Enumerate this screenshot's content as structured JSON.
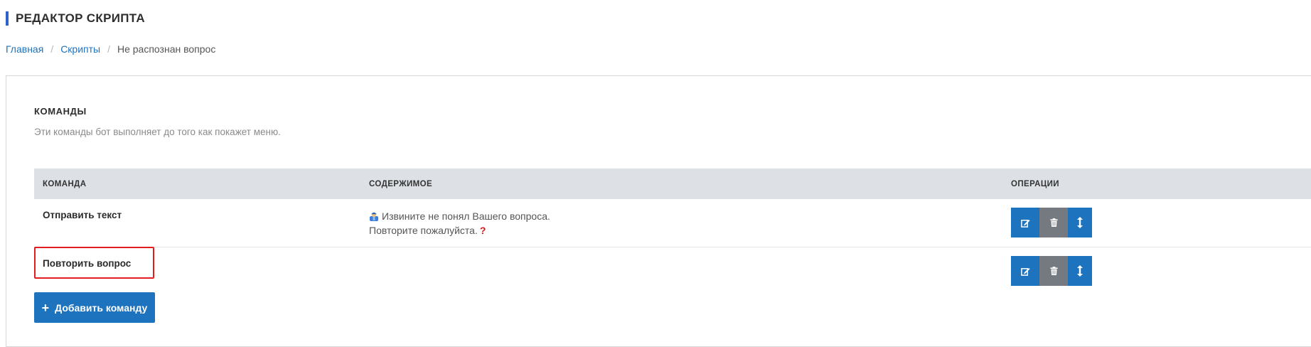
{
  "header": {
    "title": "РЕДАКТОР СКРИПТА"
  },
  "breadcrumb": {
    "home": "Главная",
    "scripts": "Скрипты",
    "current": "Не распознан вопрос"
  },
  "section": {
    "title": "КОМАНДЫ",
    "description": "Эти команды бот выполняет до того как покажет меню."
  },
  "table": {
    "headers": {
      "command": "КОМАНДА",
      "content": "СОДЕРЖИМОЕ",
      "operations": "ОПЕРАЦИИ"
    },
    "rows": [
      {
        "command": "Отправить текст",
        "content_line1": "Извините не понял Вашего вопроса.",
        "content_line2": "Повторите пожалуйста."
      },
      {
        "command": "Повторить вопрос",
        "content_line1": "",
        "content_line2": ""
      }
    ]
  },
  "add_button": {
    "label": "Добавить команду"
  },
  "colors": {
    "accent": "#1e73be",
    "delete": "#757a80",
    "highlight": "#e11d1d"
  },
  "icons": [
    "edit-icon",
    "trash-icon",
    "move-vertical-icon",
    "plus-icon",
    "worker-emoji-icon",
    "question-mark-emoji-icon"
  ]
}
